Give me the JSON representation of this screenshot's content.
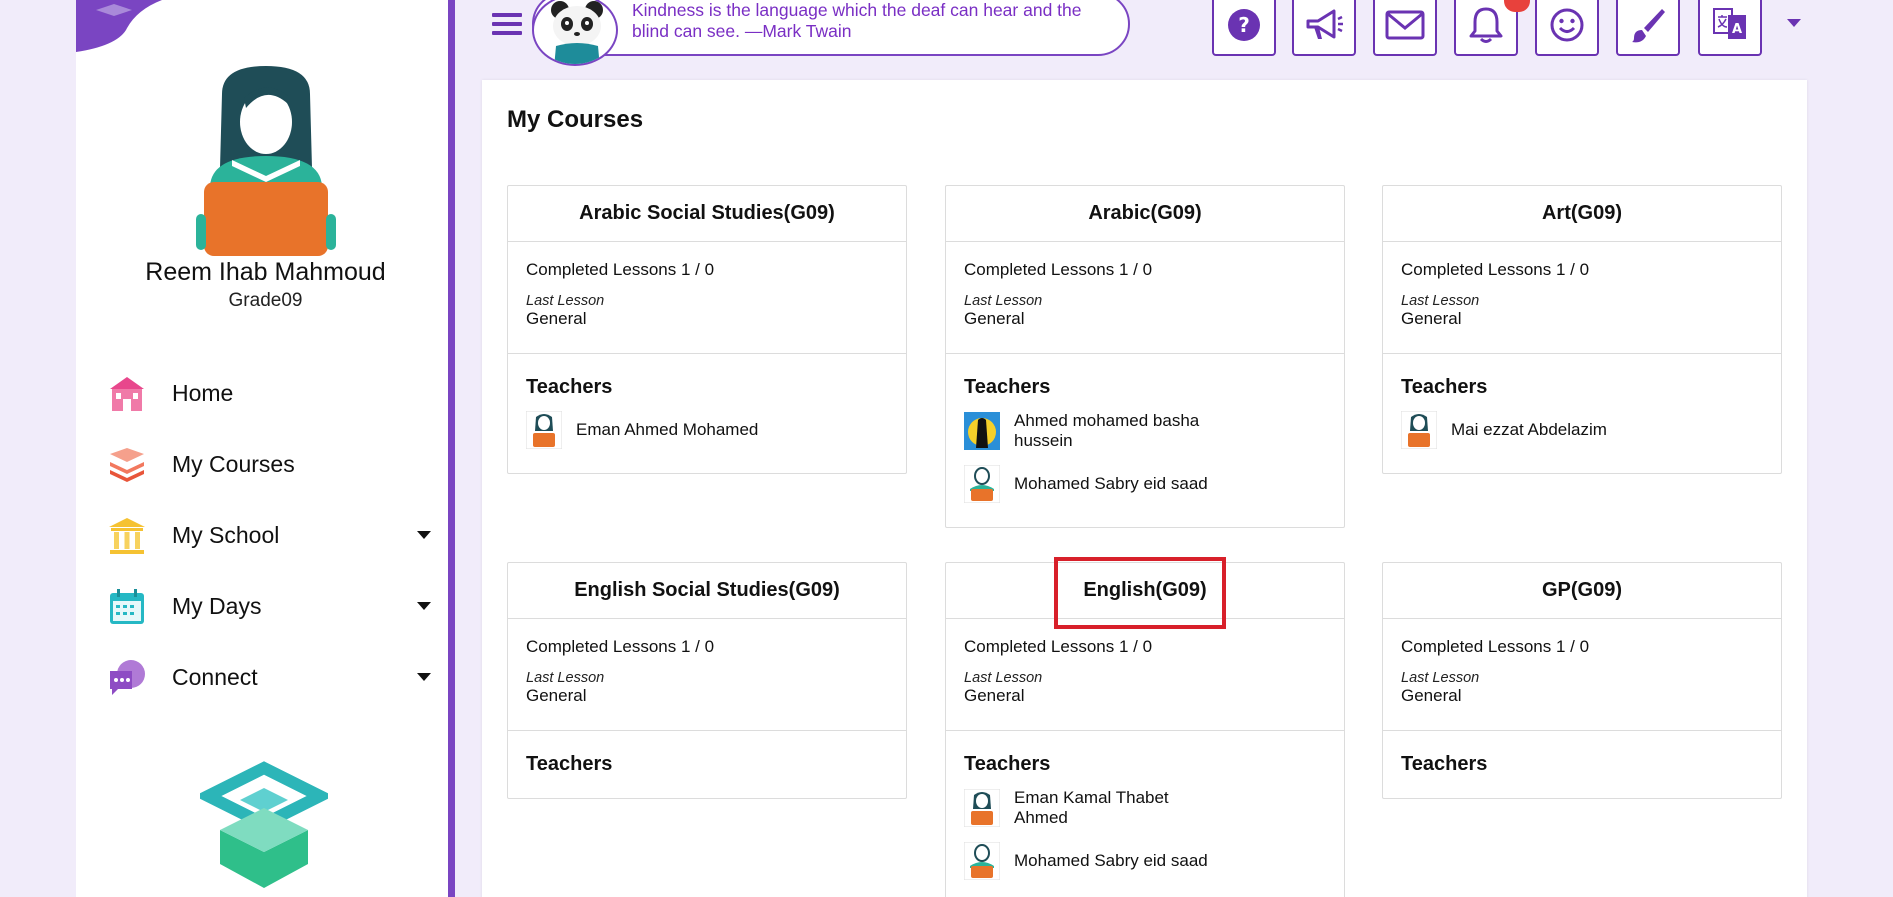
{
  "user": {
    "name": "Reem Ihab Mahmoud",
    "grade": "Grade09"
  },
  "nav": [
    {
      "label": "Home",
      "icon": "home-school-icon",
      "has_submenu": false
    },
    {
      "label": "My Courses",
      "icon": "books-stack-icon",
      "has_submenu": false
    },
    {
      "label": "My School",
      "icon": "school-columns-icon",
      "has_submenu": true
    },
    {
      "label": "My Days",
      "icon": "calendar-icon",
      "has_submenu": true
    },
    {
      "label": "Connect",
      "icon": "chat-bubbles-icon",
      "has_submenu": true
    }
  ],
  "quote": {
    "text": "Kindness is the language which the deaf can hear and the blind can see. —Mark Twain"
  },
  "toolbar": {
    "buttons": [
      "help-icon",
      "megaphone-icon",
      "mail-icon",
      "bell-icon",
      "smiley-icon",
      "paintbrush-icon",
      "translate-icon"
    ],
    "notification_count": ""
  },
  "page": {
    "title": "My Courses"
  },
  "courses": [
    {
      "title": "Arabic Social Studies(G09)",
      "completed": "Completed Lessons 1 / 0",
      "last_lesson_label": "Last Lesson",
      "last_lesson": "General",
      "teachers_label": "Teachers",
      "teachers": [
        "Eman Ahmed Mohamed"
      ]
    },
    {
      "title": "Arabic(G09)",
      "completed": "Completed Lessons 1 / 0",
      "last_lesson_label": "Last Lesson",
      "last_lesson": "General",
      "teachers_label": "Teachers",
      "teachers": [
        "Ahmed mohamed basha hussein",
        "Mohamed Sabry eid saad"
      ]
    },
    {
      "title": "Art(G09)",
      "completed": "Completed Lessons 1 / 0",
      "last_lesson_label": "Last Lesson",
      "last_lesson": "General",
      "teachers_label": "Teachers",
      "teachers": [
        "Mai ezzat Abdelazim"
      ]
    },
    {
      "title": "English Social Studies(G09)",
      "completed": "Completed Lessons 1 / 0",
      "last_lesson_label": "Last Lesson",
      "last_lesson": "General",
      "teachers_label": "Teachers",
      "teachers": []
    },
    {
      "title": "English(G09)",
      "completed": "Completed Lessons 1 / 0",
      "last_lesson_label": "Last Lesson",
      "last_lesson": "General",
      "teachers_label": "Teachers",
      "teachers": [
        "Eman Kamal Thabet Ahmed",
        "Mohamed Sabry eid saad"
      ]
    },
    {
      "title": "GP(G09)",
      "completed": "Completed Lessons 1 / 0",
      "last_lesson_label": "Last Lesson",
      "last_lesson": "General",
      "teachers_label": "Teachers",
      "teachers": []
    }
  ],
  "colors": {
    "accent": "#7a45c2",
    "page_bg": "#f1ecfa",
    "quote_text": "#7a2fc4",
    "highlight": "#d8202a"
  }
}
